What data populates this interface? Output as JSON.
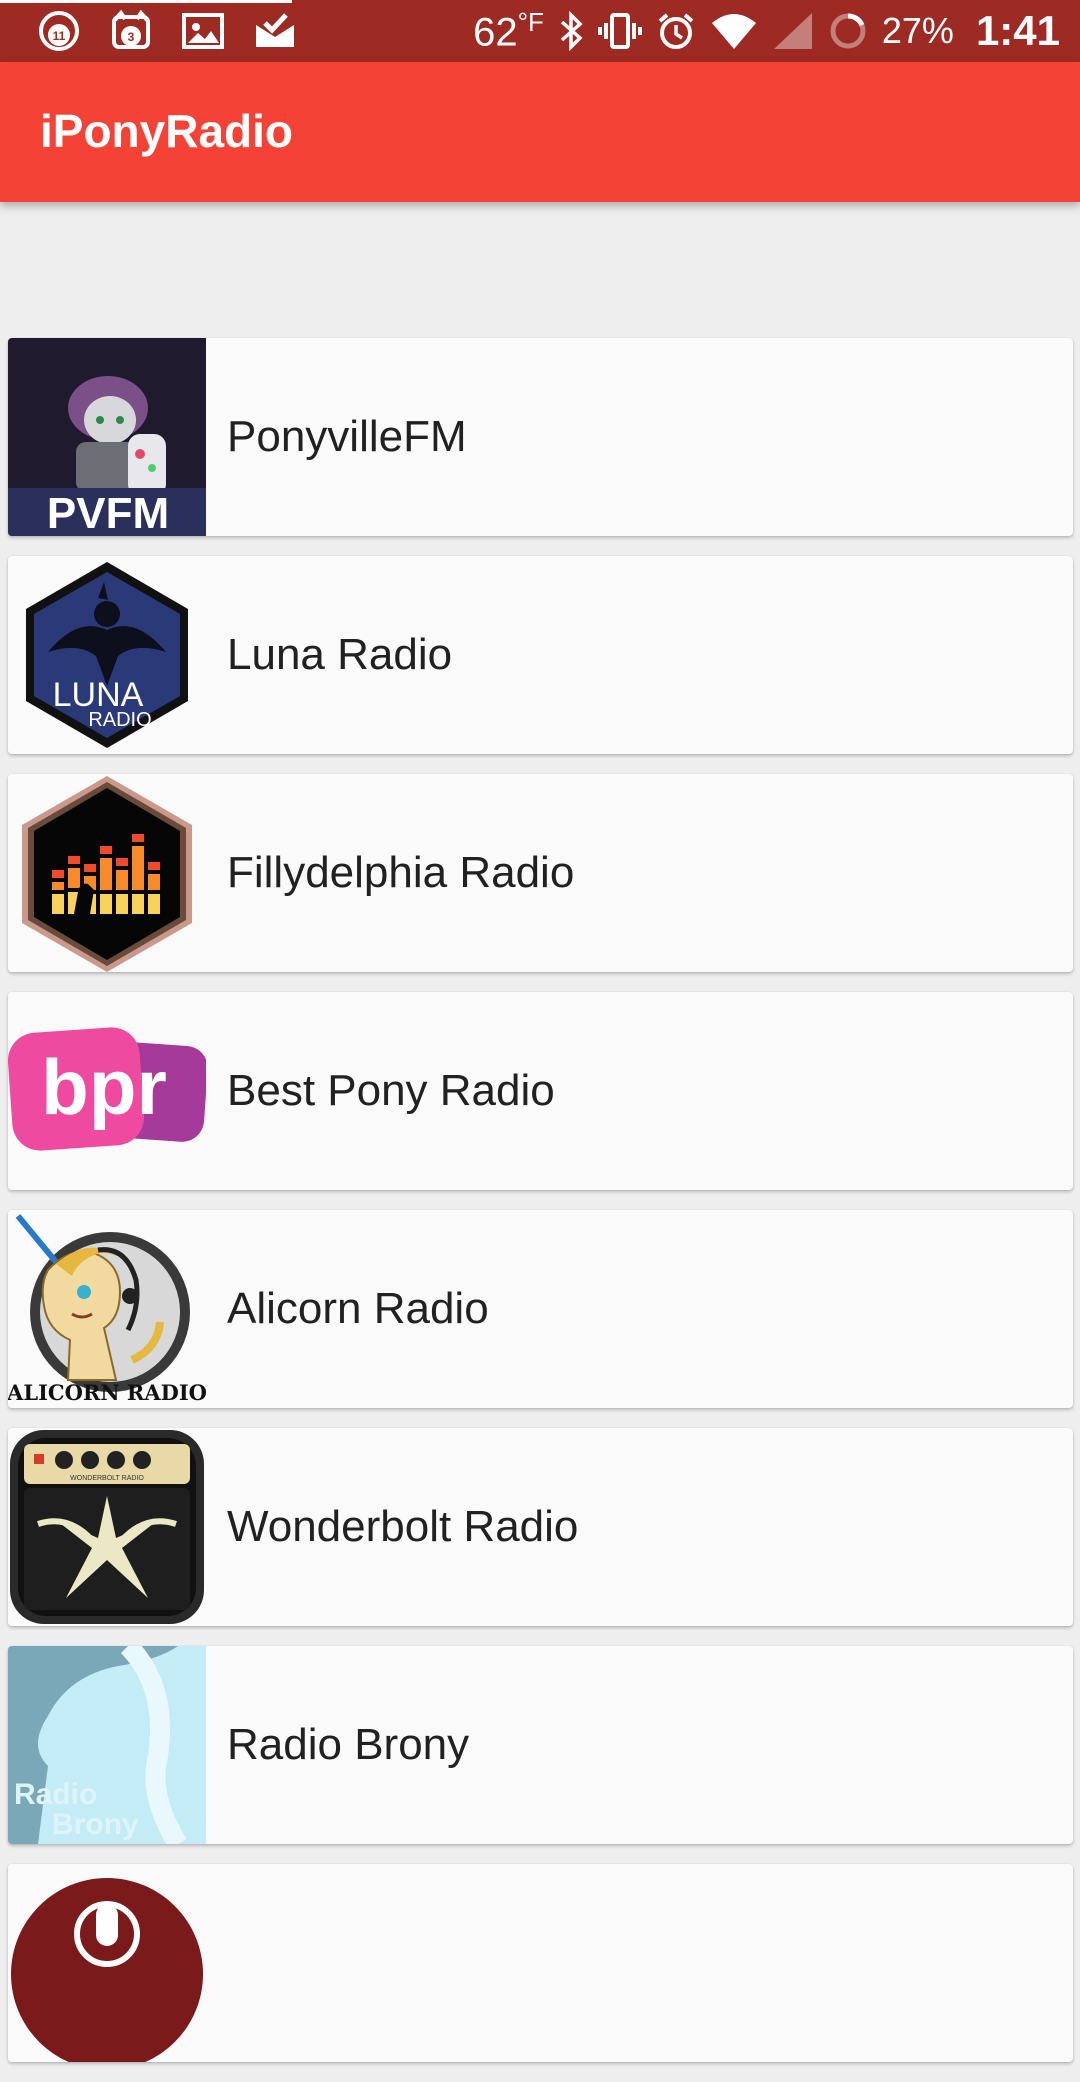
{
  "status_bar": {
    "notifications": [
      {
        "icon": "app-notification-icon",
        "badge": "11"
      },
      {
        "icon": "app-notification-icon",
        "badge": "3"
      },
      {
        "icon": "image-icon"
      },
      {
        "icon": "mail-check-icon"
      }
    ],
    "temperature": "62",
    "temperature_unit": "°F",
    "battery": "27%",
    "time": "1:41",
    "icons": [
      "bluetooth-icon",
      "vibrate-icon",
      "alarm-icon",
      "wifi-icon",
      "cell-signal-icon",
      "battery-icon"
    ]
  },
  "app_bar": {
    "title": "iPonyRadio",
    "color": "#f44336"
  },
  "stations": [
    {
      "name": "PonyvilleFM",
      "logo": "ponyvillefm-logo",
      "logo_text": "PVFM"
    },
    {
      "name": "Luna Radio",
      "logo": "luna-radio-logo",
      "logo_text": "LUNA RADIO"
    },
    {
      "name": "Fillydelphia Radio",
      "logo": "fillydelphia-radio-logo"
    },
    {
      "name": "Best Pony Radio",
      "logo": "best-pony-radio-logo",
      "logo_text": "bpr"
    },
    {
      "name": "Alicorn Radio",
      "logo": "alicorn-radio-logo",
      "logo_text": "ALICORN RADIO"
    },
    {
      "name": "Wonderbolt Radio",
      "logo": "wonderbolt-radio-logo",
      "logo_text": "WONDERBOLT RADIO"
    },
    {
      "name": "Radio Brony",
      "logo": "radio-brony-logo",
      "logo_text": "Radio Brony"
    },
    {
      "name": "",
      "logo": "microphone-logo"
    }
  ]
}
